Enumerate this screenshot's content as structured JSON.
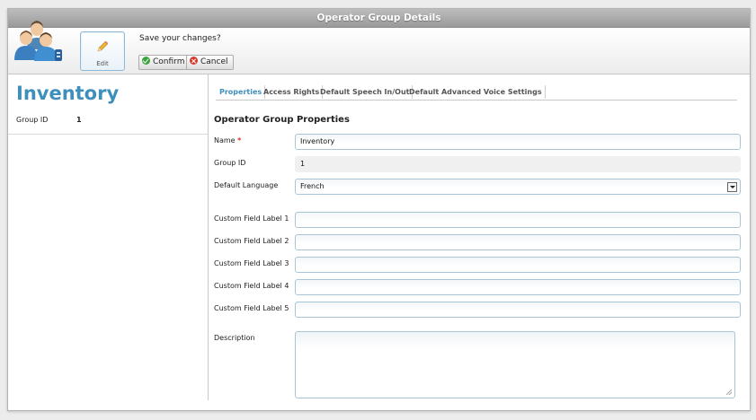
{
  "window": {
    "title": "Operator Group Details"
  },
  "toolbar": {
    "edit_label": "Edit",
    "prompt": "Save your changes?",
    "confirm_label": "Confirm",
    "cancel_label": "Cancel"
  },
  "record": {
    "title": "Inventory",
    "group_id_label": "Group ID",
    "group_id_value": "1"
  },
  "tabs": [
    {
      "label": "Properties",
      "active": true
    },
    {
      "label": "Access Rights",
      "active": false
    },
    {
      "label": "Default Speech In/Out",
      "active": false
    },
    {
      "label": "Default Advanced Voice Settings",
      "active": false
    }
  ],
  "form": {
    "section_title": "Operator Group Properties",
    "name_label": "Name",
    "name_required_marker": "*",
    "name_value": "Inventory",
    "group_id_label": "Group ID",
    "group_id_value": "1",
    "language_label": "Default Language",
    "language_value": "French",
    "custom_fields": [
      {
        "label": "Custom Field Label  1",
        "value": ""
      },
      {
        "label": "Custom Field Label  2",
        "value": ""
      },
      {
        "label": "Custom Field Label  3",
        "value": ""
      },
      {
        "label": "Custom Field Label  4",
        "value": ""
      },
      {
        "label": "Custom Field Label  5",
        "value": ""
      }
    ],
    "description_label": "Description",
    "description_value": ""
  },
  "colors": {
    "accent": "#3f8fbd",
    "titlebar": "#a8a8a8",
    "required": "#d42a2a",
    "confirm_icon": "#3aa53a",
    "cancel_icon": "#d43b2e"
  },
  "icons": {
    "header": "operator-group-users-icon",
    "edit": "pencil-icon",
    "confirm": "check-circle-icon",
    "cancel": "x-circle-icon",
    "select": "dropdown-arrow-icon"
  }
}
